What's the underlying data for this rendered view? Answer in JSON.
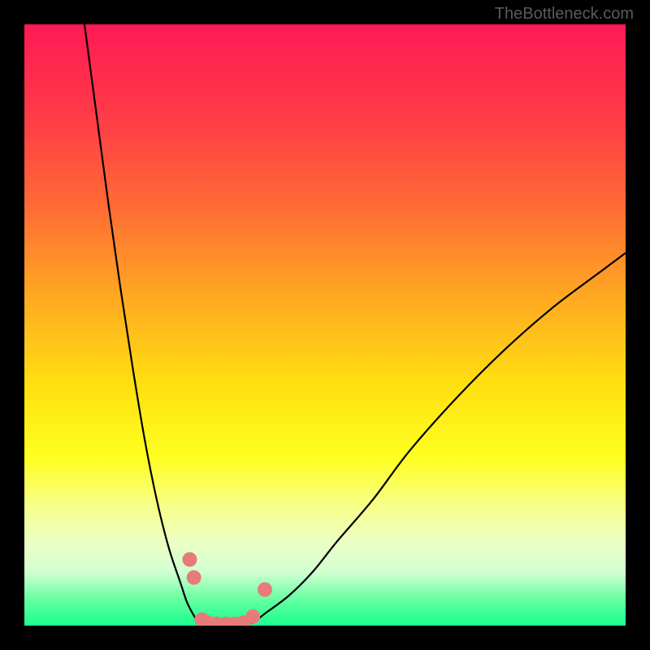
{
  "watermark": "TheBottleneck.com",
  "chart_data": {
    "type": "line",
    "title": "",
    "xlabel": "",
    "ylabel": "",
    "xlim": [
      0,
      100
    ],
    "ylim": [
      0,
      100
    ],
    "background": {
      "type": "vertical-gradient",
      "stops": [
        {
          "offset": 0,
          "color": "#ff1a55"
        },
        {
          "offset": 15,
          "color": "#ff3a47"
        },
        {
          "offset": 30,
          "color": "#ff6a35"
        },
        {
          "offset": 45,
          "color": "#ffa722"
        },
        {
          "offset": 60,
          "color": "#ffe010"
        },
        {
          "offset": 72,
          "color": "#ffff20"
        },
        {
          "offset": 80,
          "color": "#f7ff88"
        },
        {
          "offset": 86,
          "color": "#ecffc3"
        },
        {
          "offset": 91,
          "color": "#d2ffd2"
        },
        {
          "offset": 96,
          "color": "#5eff9e"
        },
        {
          "offset": 100,
          "color": "#1aff8e"
        }
      ]
    },
    "series": [
      {
        "name": "left-curve",
        "color": "#000000",
        "x": [
          10,
          12,
          14,
          16,
          18,
          20,
          22,
          24,
          26,
          27,
          28,
          29,
          30
        ],
        "y": [
          100,
          85,
          70,
          56,
          43,
          31,
          21,
          13,
          7,
          4,
          2,
          0.5,
          0
        ]
      },
      {
        "name": "right-curve",
        "color": "#000000",
        "x": [
          36,
          38,
          40,
          44,
          48,
          52,
          58,
          64,
          72,
          80,
          88,
          96,
          100
        ],
        "y": [
          0,
          0.5,
          2,
          5,
          9,
          14,
          21,
          29,
          38,
          46,
          53,
          59,
          62
        ]
      },
      {
        "name": "floor-segment",
        "color": "#000000",
        "x": [
          30,
          36
        ],
        "y": [
          0,
          0
        ]
      }
    ],
    "markers": {
      "name": "data-points",
      "color": "#e77b7b",
      "radius": 9,
      "points": [
        {
          "x": 27.5,
          "y": 11
        },
        {
          "x": 28.2,
          "y": 8
        },
        {
          "x": 29.5,
          "y": 1
        },
        {
          "x": 30.5,
          "y": 0.5
        },
        {
          "x": 32,
          "y": 0.3
        },
        {
          "x": 33.5,
          "y": 0.3
        },
        {
          "x": 35,
          "y": 0.3
        },
        {
          "x": 36.5,
          "y": 0.5
        },
        {
          "x": 38,
          "y": 1.5
        },
        {
          "x": 40,
          "y": 6
        }
      ]
    }
  }
}
